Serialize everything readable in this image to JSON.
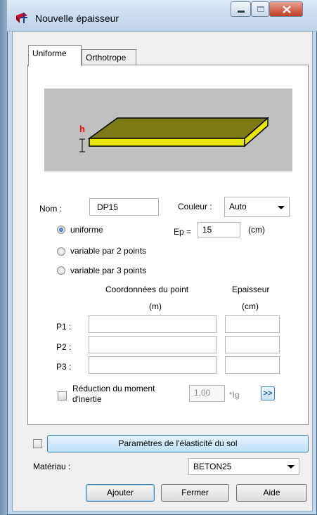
{
  "window": {
    "title": "Nouvelle épaisseur"
  },
  "tabs": [
    {
      "label": "Uniforme"
    },
    {
      "label": "Orthotrope"
    }
  ],
  "preview": {
    "h_label": "h",
    "slab_color": "#e6e600",
    "top_color": "#7d7a16",
    "bg_color": "#c0c0c0"
  },
  "form": {
    "nom_label": "Nom :",
    "nom_value": "DP15",
    "couleur_label": "Couleur :",
    "couleur_value": "Auto",
    "radios": [
      {
        "label": "uniforme",
        "checked": true
      },
      {
        "label": "variable par 2 points",
        "checked": false
      },
      {
        "label": "variable par 3 points",
        "checked": false
      }
    ],
    "ep_label": "Ep =",
    "ep_value": "15",
    "ep_unit": "(cm)",
    "coord_header": "Coordonnées du point",
    "coord_unit": "(m)",
    "epaisseur_header": "Epaisseur",
    "epaisseur_unit": "(cm)",
    "points": [
      {
        "label": "P1 :"
      },
      {
        "label": "P2 :"
      },
      {
        "label": "P3 :"
      }
    ],
    "reduction_line1": "Réduction du moment",
    "reduction_line2": "d'inertie",
    "reduction_value": "1,00",
    "reduction_unit": "*Ig",
    "more_button": ">>"
  },
  "footer": {
    "params_button": "Paramètres de l'élasticité du sol",
    "materiau_label": "Matériau :",
    "materiau_value": "BETON25",
    "ajouter": "Ajouter",
    "fermer": "Fermer",
    "aide": "Aide"
  }
}
